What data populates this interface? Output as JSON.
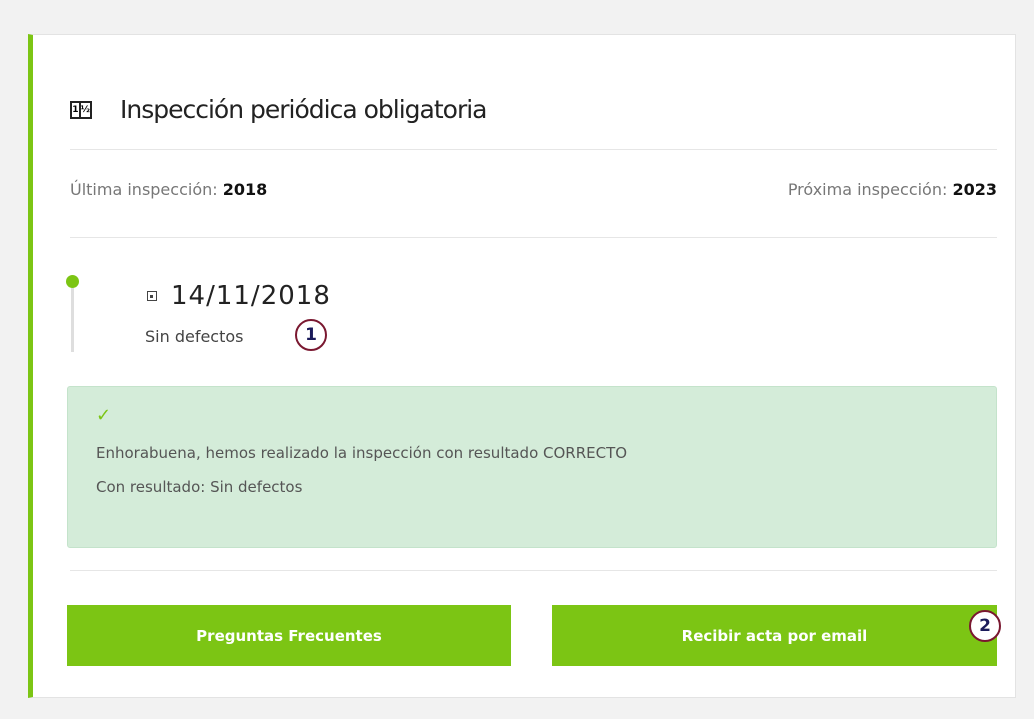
{
  "card": {
    "title": "Inspección periódica obligatoria",
    "title_icon": "registration-plate-icon",
    "last_label": "Última inspección:",
    "last_value": "2018",
    "next_label": "Próxima inspección:",
    "next_value": "2023"
  },
  "timeline": {
    "date": "14/11/2018",
    "result": "Sin defectos"
  },
  "alert": {
    "line1": "Enhorabuena, hemos realizado la inspección con resultado CORRECTO",
    "line2": "Con resultado: Sin defectos"
  },
  "buttons": {
    "faq": "Preguntas Frecuentes",
    "email": "Recibir acta por email"
  },
  "markers": [
    "1",
    "2"
  ],
  "colors": {
    "accent": "#7cc514",
    "alert_bg": "#d4ecd9",
    "marker_border": "#7a1830"
  }
}
